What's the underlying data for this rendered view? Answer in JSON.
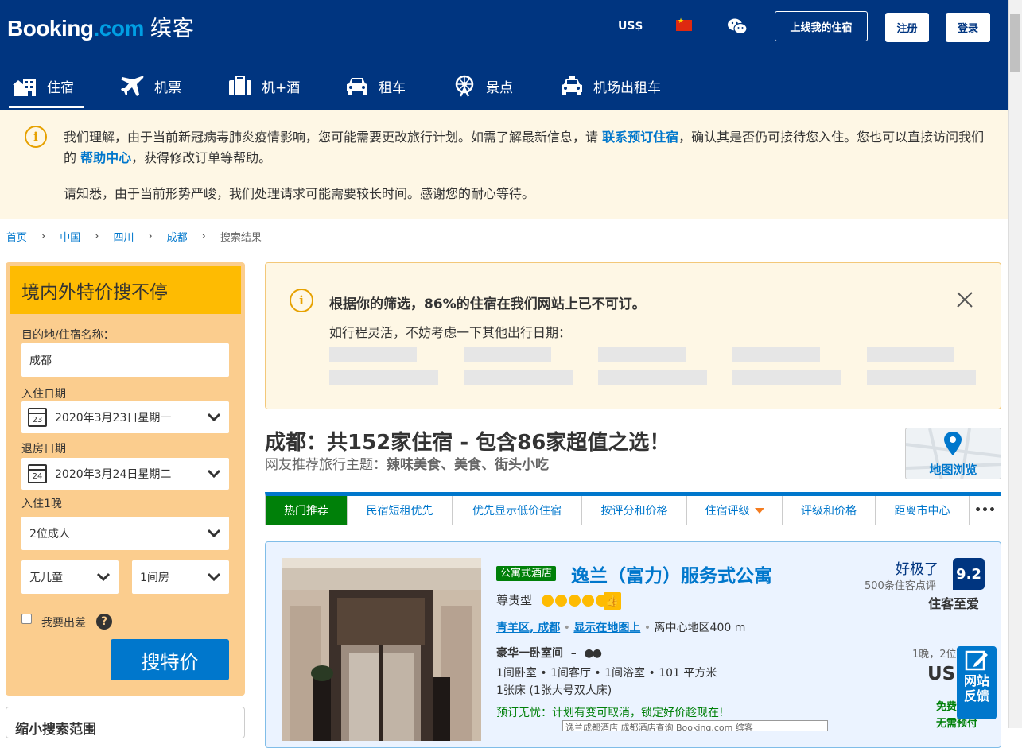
{
  "header": {
    "logo_main": "Booking",
    "logo_dot": ".com",
    "logo_cn": "缤客",
    "currency": "US$",
    "list_property": "上线我的住宿",
    "register": "注册",
    "login": "登录",
    "brand_color": "#003580"
  },
  "nav": {
    "tabs": [
      {
        "label": "住宿",
        "icon": "bed-icon"
      },
      {
        "label": "机票",
        "icon": "plane-icon"
      },
      {
        "label": "机+酒",
        "icon": "suitcase-icon"
      },
      {
        "label": "租车",
        "icon": "car-icon"
      },
      {
        "label": "景点",
        "icon": "attraction-icon"
      },
      {
        "label": "机场出租车",
        "icon": "taxi-icon"
      }
    ]
  },
  "alert": {
    "p1_a": "我们理解，由于当前新冠病毒肺炎疫情影响，您可能需要更改旅行计划。如需了解最新信息，请 ",
    "p1_link1": "联系预订住宿",
    "p1_b": "，确认其是否仍可接待您入住。您也可以直接访问我们的 ",
    "p1_link2": "帮助中心",
    "p1_c": "，获得修改订单等帮助。",
    "p2": "请知悉，由于当前形势严峻，我们处理请求可能需要较长时间。感谢您的耐心等待。"
  },
  "breadcrumb": [
    "首页",
    "中国",
    "四川",
    "成都",
    "搜索结果"
  ],
  "search": {
    "title": "境内外特价搜不停",
    "dest_label": "目的地/住宿名称：",
    "dest_value": "成都",
    "checkin_label": "入住日期",
    "checkin_day": "23",
    "checkin_value": "2020年3月23日星期一",
    "checkout_label": "退房日期",
    "checkout_day": "24",
    "checkout_value": "2020年3月24日星期二",
    "nights": "入住1晚",
    "adults": "2位成人",
    "children": "无儿童",
    "rooms": "1间房",
    "business": "我要出差",
    "button": "搜特价",
    "filter_title": "缩小搜索范围"
  },
  "notice": {
    "title": "根据你的筛选，86%的住宿在我们网站上已不可订。",
    "subtitle": "如行程灵活，不妨考虑一下其他出行日期："
  },
  "results": {
    "title": "成都：共152家住宿 - 包含86家超值之选！",
    "theme_prefix": "网友推荐旅行主题：",
    "theme_tags": "辣味美食、美食、街头小吃",
    "map_label": "地图浏览"
  },
  "sort_tabs": [
    "热门推荐",
    "民宿短租优先",
    "优先显示低价住宿",
    "按评分和价格",
    "住宿评级",
    "评级和价格",
    "距离市中心",
    "•••"
  ],
  "hotel": {
    "type_badge": "公寓式酒店",
    "name": "逸兰（富力）服务式公寓",
    "class_label": "尊贵型",
    "stars": 5,
    "district": "青羊区, 成都",
    "show_map": "显示在地图上",
    "distance": "离中心地区400 m",
    "room_name": "豪华一卧室间",
    "room_dash": "–",
    "room_detail": "1间卧室 • 1间客厅 • 1间浴室 • 101 平方米",
    "bed": "1张床 (1张大号双人床)",
    "free_cancel": "预订无忧：计划有变可取消，锁定好价趁现在!",
    "rating_word": "好极了",
    "reviews": "500条住客点评",
    "score": "9.2",
    "fav": "住客至爱",
    "price_nights": "1晚，2位",
    "currency": "US$",
    "free1": "免费",
    "free2": "无需预付"
  },
  "feedback": {
    "line1": "网站",
    "line2": "反馈"
  },
  "tooltip": "逸兰成都酒店 成都酒店查询 Booking.com 缤客"
}
